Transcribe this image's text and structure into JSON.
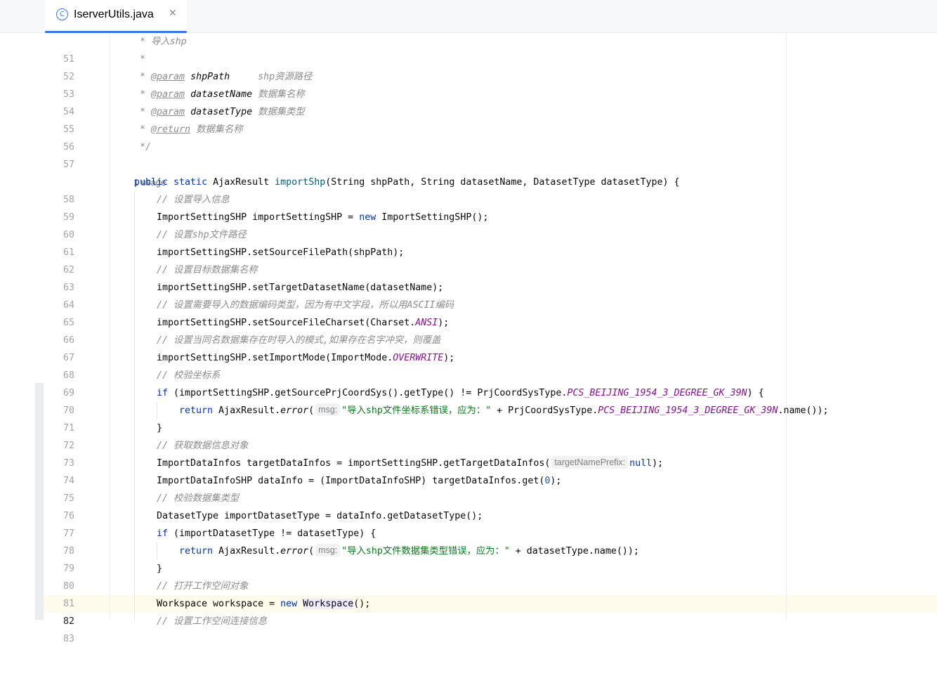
{
  "tab": {
    "title": "IserverUtils.java",
    "icon": "class-icon",
    "close_glyph": "✕"
  },
  "editor": {
    "usage_label": "1 usage",
    "line_numbers": [
      "51",
      "52",
      "53",
      "54",
      "55",
      "56",
      "57",
      "58",
      "59",
      "60",
      "61",
      "62",
      "63",
      "64",
      "65",
      "66",
      "67",
      "68",
      "69",
      "70",
      "71",
      "72",
      "73",
      "74",
      "75",
      "76",
      "77",
      "78",
      "79",
      "80",
      "81",
      "82",
      "83"
    ],
    "current_line": "82",
    "comments": {
      "l51": " * 导入shp",
      "l52": " *",
      "l53_tag": "@param",
      "l53_name": "shpPath",
      "l53_desc": "shp资源路径",
      "l54_tag": "@param",
      "l54_name": "datasetName",
      "l54_desc": "数据集名称",
      "l55_tag": "@param",
      "l55_name": "datasetType",
      "l55_desc": "数据集类型",
      "l56_tag": "@return",
      "l56_desc": "数据集名称",
      "l57": " */",
      "l59": "// 设置导入信息",
      "l61": "// 设置shp文件路径",
      "l63": "// 设置目标数据集名称",
      "l65": "// 设置需要导入的数据编码类型，因为有中文字段，所以用ASCII编码",
      "l67": "// 设置当同名数据集存在时导入的模式,如果存在名字冲突，则覆盖",
      "l69": "// 校验坐标系",
      "l73": "// 获取数据信息对象",
      "l76": "// 校验数据集类型",
      "l81": "// 打开工作空间对象",
      "l83": "// 设置工作空间连接信息"
    },
    "hints": {
      "msg": "msg:",
      "target_prefix": "targetNamePrefix:"
    },
    "strings": {
      "l71": "\"导入shp文件坐标系错误，应为：\"",
      "l79": "\"导入shp文件数据集类型错误，应为：\""
    },
    "code": {
      "l58_a": "public static",
      "l58_b": " AjaxResult ",
      "l58_m": "importShp",
      "l58_c": "(String shpPath, String datasetName, DatasetType datasetType) {",
      "l60_a": "ImportSettingSHP importSettingSHP = ",
      "l60_k": "new",
      "l60_b": " ImportSettingSHP();",
      "l62": "importSettingSHP.setSourceFilePath(shpPath);",
      "l64": "importSettingSHP.setTargetDatasetName(datasetName);",
      "l66_a": "importSettingSHP.setSourceFileCharset(Charset.",
      "l66_f": "ANSI",
      "l66_b": ");",
      "l68_a": "importSettingSHP.setImportMode(ImportMode.",
      "l68_f": "OVERWRITE",
      "l68_b": ");",
      "l70_k": "if",
      "l70_a": " (importSettingSHP.getSourcePrjCoordSys().getType() != PrjCoordSysType.",
      "l70_f": "PCS_BEIJING_1954_3_DEGREE_GK_39N",
      "l70_b": ") {",
      "l71_k": "return",
      "l71_a": " AjaxResult.",
      "l71_m": "error",
      "l71_b": "(",
      "l71_c": " + PrjCoordSysType.",
      "l71_f": "PCS_BEIJING_1954_3_DEGREE_GK_39N",
      "l71_d": ".name());",
      "l72": "}",
      "l74_a": "ImportDataInfos targetDataInfos = importSettingSHP.getTargetDataInfos(",
      "l74_k": "null",
      "l74_b": ");",
      "l75_a": "ImportDataInfoSHP dataInfo = (ImportDataInfoSHP) targetDataInfos.get(",
      "l75_n": "0",
      "l75_b": ");",
      "l77": "DatasetType importDatasetType = dataInfo.getDatasetType();",
      "l78_k": "if",
      "l78_a": " (importDatasetType != datasetType) {",
      "l79_k": "return",
      "l79_a": " AjaxResult.",
      "l79_m": "error",
      "l79_b": "(",
      "l79_c": " + datasetType.name());",
      "l80": "}",
      "l82_a": "Workspace workspace = ",
      "l82_k": "new",
      "l82_sp": " ",
      "l82_h": "Workspace",
      "l82_b": "();"
    }
  }
}
